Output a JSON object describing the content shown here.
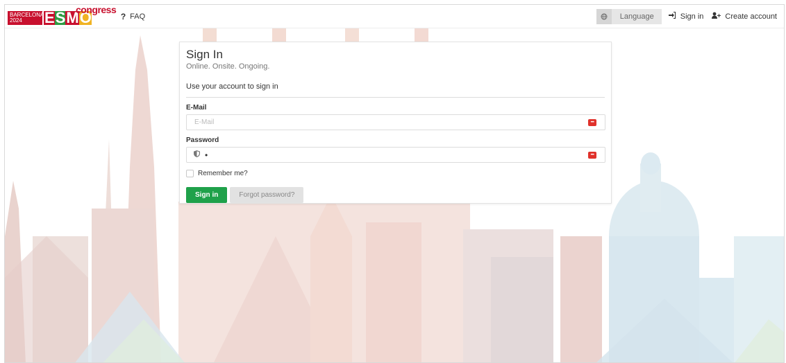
{
  "logo": {
    "city_line1": "BARCELONA",
    "city_line2": "2024",
    "esmo_letters": [
      "E",
      "S",
      "M",
      "O"
    ],
    "congress": "congress"
  },
  "nav": {
    "faq_icon": "?",
    "faq_label": "FAQ",
    "language_icon": "globe-icon",
    "language_label": "Language",
    "signin_label": "Sign in",
    "create_account_label": "Create account"
  },
  "card": {
    "title": "Sign In",
    "subtitle": "Online. Onsite. Ongoing.",
    "hint": "Use your account to sign in",
    "email_label": "E-Mail",
    "email_placeholder": "E-Mail",
    "email_value": "",
    "password_label": "Password",
    "password_value": "•",
    "password_manager_glyph": "•••",
    "remember_label": "Remember me?",
    "signin_button": "Sign in",
    "forgot_button": "Forgot password?"
  },
  "colors": {
    "brand_red": "#c8102e",
    "brand_green": "#2e9d44",
    "brand_yellow": "#f0b323",
    "button_green": "#1fa14a"
  }
}
